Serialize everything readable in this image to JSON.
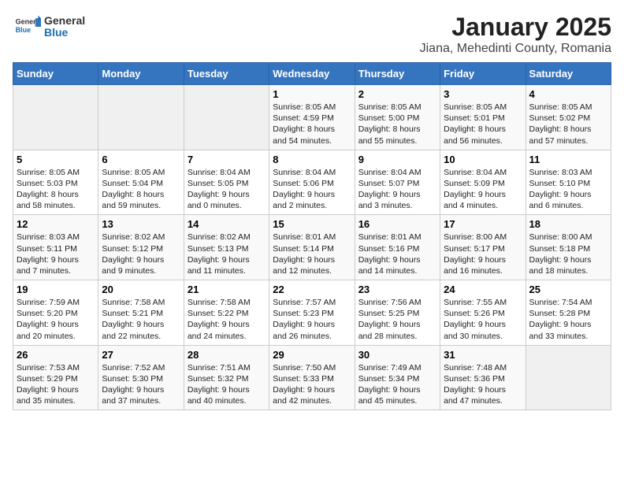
{
  "logo": {
    "general": "General",
    "blue": "Blue"
  },
  "title": "January 2025",
  "subtitle": "Jiana, Mehedinti County, Romania",
  "weekdays": [
    "Sunday",
    "Monday",
    "Tuesday",
    "Wednesday",
    "Thursday",
    "Friday",
    "Saturday"
  ],
  "weeks": [
    [
      {
        "day": "",
        "info": ""
      },
      {
        "day": "",
        "info": ""
      },
      {
        "day": "",
        "info": ""
      },
      {
        "day": "1",
        "info": "Sunrise: 8:05 AM\nSunset: 4:59 PM\nDaylight: 8 hours\nand 54 minutes."
      },
      {
        "day": "2",
        "info": "Sunrise: 8:05 AM\nSunset: 5:00 PM\nDaylight: 8 hours\nand 55 minutes."
      },
      {
        "day": "3",
        "info": "Sunrise: 8:05 AM\nSunset: 5:01 PM\nDaylight: 8 hours\nand 56 minutes."
      },
      {
        "day": "4",
        "info": "Sunrise: 8:05 AM\nSunset: 5:02 PM\nDaylight: 8 hours\nand 57 minutes."
      }
    ],
    [
      {
        "day": "5",
        "info": "Sunrise: 8:05 AM\nSunset: 5:03 PM\nDaylight: 8 hours\nand 58 minutes."
      },
      {
        "day": "6",
        "info": "Sunrise: 8:05 AM\nSunset: 5:04 PM\nDaylight: 8 hours\nand 59 minutes."
      },
      {
        "day": "7",
        "info": "Sunrise: 8:04 AM\nSunset: 5:05 PM\nDaylight: 9 hours\nand 0 minutes."
      },
      {
        "day": "8",
        "info": "Sunrise: 8:04 AM\nSunset: 5:06 PM\nDaylight: 9 hours\nand 2 minutes."
      },
      {
        "day": "9",
        "info": "Sunrise: 8:04 AM\nSunset: 5:07 PM\nDaylight: 9 hours\nand 3 minutes."
      },
      {
        "day": "10",
        "info": "Sunrise: 8:04 AM\nSunset: 5:09 PM\nDaylight: 9 hours\nand 4 minutes."
      },
      {
        "day": "11",
        "info": "Sunrise: 8:03 AM\nSunset: 5:10 PM\nDaylight: 9 hours\nand 6 minutes."
      }
    ],
    [
      {
        "day": "12",
        "info": "Sunrise: 8:03 AM\nSunset: 5:11 PM\nDaylight: 9 hours\nand 7 minutes."
      },
      {
        "day": "13",
        "info": "Sunrise: 8:02 AM\nSunset: 5:12 PM\nDaylight: 9 hours\nand 9 minutes."
      },
      {
        "day": "14",
        "info": "Sunrise: 8:02 AM\nSunset: 5:13 PM\nDaylight: 9 hours\nand 11 minutes."
      },
      {
        "day": "15",
        "info": "Sunrise: 8:01 AM\nSunset: 5:14 PM\nDaylight: 9 hours\nand 12 minutes."
      },
      {
        "day": "16",
        "info": "Sunrise: 8:01 AM\nSunset: 5:16 PM\nDaylight: 9 hours\nand 14 minutes."
      },
      {
        "day": "17",
        "info": "Sunrise: 8:00 AM\nSunset: 5:17 PM\nDaylight: 9 hours\nand 16 minutes."
      },
      {
        "day": "18",
        "info": "Sunrise: 8:00 AM\nSunset: 5:18 PM\nDaylight: 9 hours\nand 18 minutes."
      }
    ],
    [
      {
        "day": "19",
        "info": "Sunrise: 7:59 AM\nSunset: 5:20 PM\nDaylight: 9 hours\nand 20 minutes."
      },
      {
        "day": "20",
        "info": "Sunrise: 7:58 AM\nSunset: 5:21 PM\nDaylight: 9 hours\nand 22 minutes."
      },
      {
        "day": "21",
        "info": "Sunrise: 7:58 AM\nSunset: 5:22 PM\nDaylight: 9 hours\nand 24 minutes."
      },
      {
        "day": "22",
        "info": "Sunrise: 7:57 AM\nSunset: 5:23 PM\nDaylight: 9 hours\nand 26 minutes."
      },
      {
        "day": "23",
        "info": "Sunrise: 7:56 AM\nSunset: 5:25 PM\nDaylight: 9 hours\nand 28 minutes."
      },
      {
        "day": "24",
        "info": "Sunrise: 7:55 AM\nSunset: 5:26 PM\nDaylight: 9 hours\nand 30 minutes."
      },
      {
        "day": "25",
        "info": "Sunrise: 7:54 AM\nSunset: 5:28 PM\nDaylight: 9 hours\nand 33 minutes."
      }
    ],
    [
      {
        "day": "26",
        "info": "Sunrise: 7:53 AM\nSunset: 5:29 PM\nDaylight: 9 hours\nand 35 minutes."
      },
      {
        "day": "27",
        "info": "Sunrise: 7:52 AM\nSunset: 5:30 PM\nDaylight: 9 hours\nand 37 minutes."
      },
      {
        "day": "28",
        "info": "Sunrise: 7:51 AM\nSunset: 5:32 PM\nDaylight: 9 hours\nand 40 minutes."
      },
      {
        "day": "29",
        "info": "Sunrise: 7:50 AM\nSunset: 5:33 PM\nDaylight: 9 hours\nand 42 minutes."
      },
      {
        "day": "30",
        "info": "Sunrise: 7:49 AM\nSunset: 5:34 PM\nDaylight: 9 hours\nand 45 minutes."
      },
      {
        "day": "31",
        "info": "Sunrise: 7:48 AM\nSunset: 5:36 PM\nDaylight: 9 hours\nand 47 minutes."
      },
      {
        "day": "",
        "info": ""
      }
    ]
  ]
}
